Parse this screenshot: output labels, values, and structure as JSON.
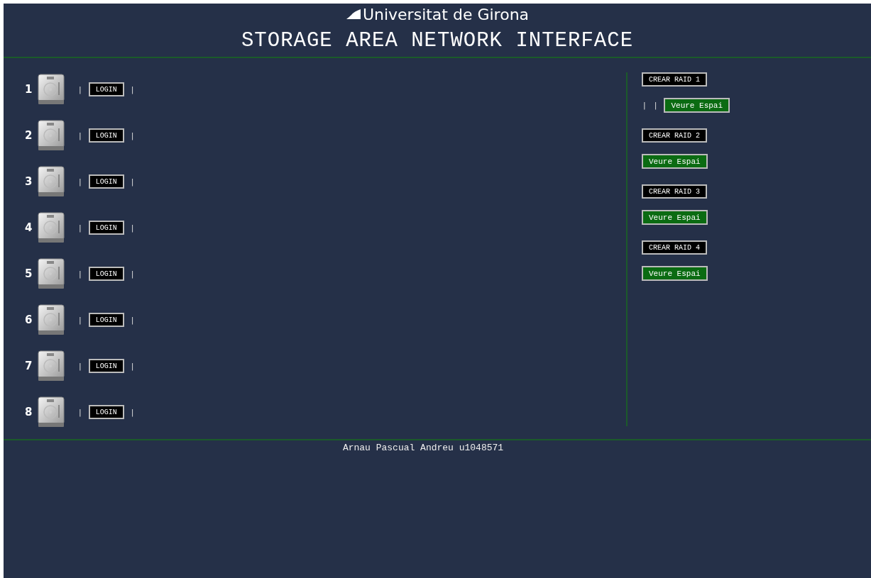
{
  "header": {
    "university": "Universitat de Girona",
    "title": "STORAGE AREA NETWORK INTERFACE"
  },
  "disks": [
    {
      "number": "1",
      "separator_left": "|",
      "button": "LOGIN",
      "separator_right": "|"
    },
    {
      "number": "2",
      "separator_left": "|",
      "button": "LOGIN",
      "separator_right": "|"
    },
    {
      "number": "3",
      "separator_left": "|",
      "button": "LOGIN",
      "separator_right": "|"
    },
    {
      "number": "4",
      "separator_left": "|",
      "button": "LOGIN",
      "separator_right": "|"
    },
    {
      "number": "5",
      "separator_left": "|",
      "button": "LOGIN",
      "separator_right": "|"
    },
    {
      "number": "6",
      "separator_left": "|",
      "button": "LOGIN",
      "separator_right": "|"
    },
    {
      "number": "7",
      "separator_left": "|",
      "button": "LOGIN",
      "separator_right": "|"
    },
    {
      "number": "8",
      "separator_left": "|",
      "button": "LOGIN",
      "separator_right": "|"
    }
  ],
  "raids": [
    {
      "button": "CREAR RAID 1",
      "separators": [
        "|",
        "|"
      ],
      "view_button": "Veure Espai"
    },
    {
      "button": "CREAR RAID 2",
      "view_button": "Veure Espai"
    },
    {
      "button": "CREAR RAID 3",
      "view_button": "Veure Espai"
    },
    {
      "button": "CREAR RAID 4",
      "view_button": "Veure Espai"
    }
  ],
  "footer": "Arnau Pascual Andreu u1048571"
}
